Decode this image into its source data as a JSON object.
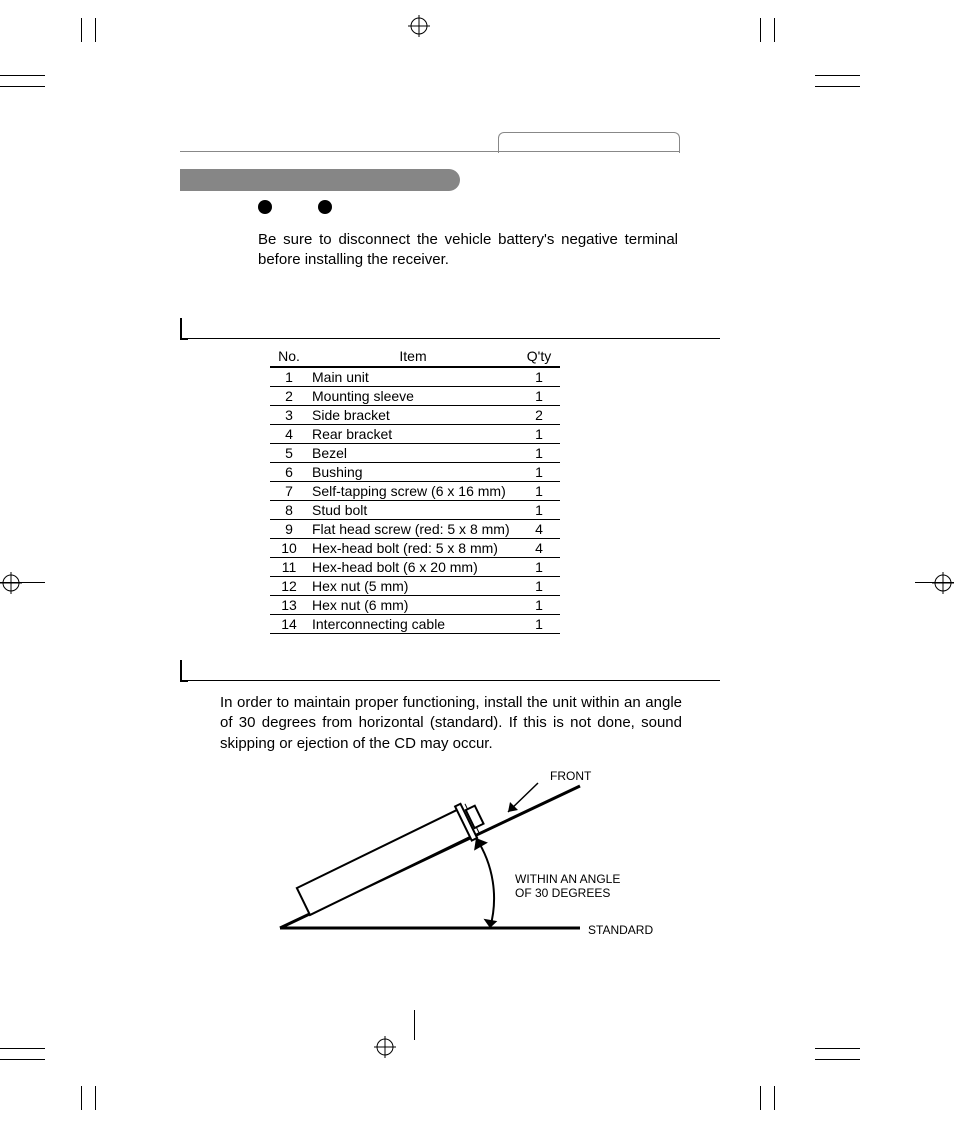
{
  "warning_text": "Be sure to disconnect the vehicle battery's negative terminal before installing the receiver.",
  "parts_header": {
    "no": "No.",
    "item": "Item",
    "qty": "Q'ty"
  },
  "parts": [
    {
      "no": "1",
      "item": "Main unit",
      "qty": "1"
    },
    {
      "no": "2",
      "item": "Mounting sleeve",
      "qty": "1"
    },
    {
      "no": "3",
      "item": "Side bracket",
      "qty": "2"
    },
    {
      "no": "4",
      "item": "Rear bracket",
      "qty": "1"
    },
    {
      "no": "5",
      "item": "Bezel",
      "qty": "1"
    },
    {
      "no": "6",
      "item": "Bushing",
      "qty": "1"
    },
    {
      "no": "7",
      "item": "Self-tapping screw (6 x 16 mm)",
      "qty": "1"
    },
    {
      "no": "8",
      "item": "Stud bolt",
      "qty": "1"
    },
    {
      "no": "9",
      "item": "Flat head screw (red: 5 x 8 mm)",
      "qty": "4"
    },
    {
      "no": "10",
      "item": "Hex-head bolt (red: 5 x 8 mm)",
      "qty": "4"
    },
    {
      "no": "11",
      "item": "Hex-head bolt (6 x 20 mm)",
      "qty": "1"
    },
    {
      "no": "12",
      "item": "Hex nut (5 mm)",
      "qty": "1"
    },
    {
      "no": "13",
      "item": "Hex nut (6 mm)",
      "qty": "1"
    },
    {
      "no": "14",
      "item": "Interconnecting cable",
      "qty": "1"
    }
  ],
  "angle_text": "In order to maintain proper functioning, install the unit within an angle of 30 degrees from horizontal (standard). If this is not done, sound skipping or ejection of the CD may occur.",
  "diagram": {
    "front": "FRONT",
    "within": "WITHIN AN ANGLE OF 30 DEGREES",
    "standard": "STANDARD"
  }
}
